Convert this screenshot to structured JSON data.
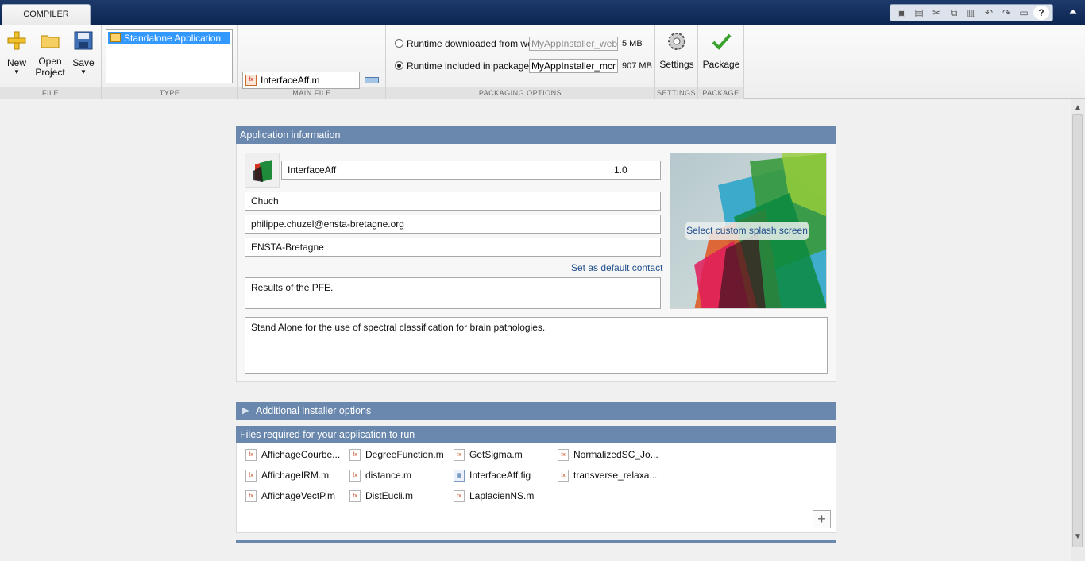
{
  "tabs": {
    "compiler": "COMPILER"
  },
  "quick_access": [
    "new-icon",
    "save-icon",
    "cut-icon",
    "copy-icon",
    "paste-icon",
    "undo-icon",
    "redo-icon",
    "window-icon",
    "help-icon"
  ],
  "toolstrip": {
    "file": {
      "section_label": "FILE",
      "new": "New",
      "open_line1": "Open",
      "open_line2": "Project",
      "save": "Save"
    },
    "type": {
      "section_label": "TYPE",
      "selected": "Standalone Application"
    },
    "main_file": {
      "section_label": "MAIN FILE",
      "file": "InterfaceAff.m"
    },
    "packaging": {
      "section_label": "PACKAGING OPTIONS",
      "web_label": "Runtime downloaded from web",
      "web_value": "MyAppInstaller_web",
      "web_size": "5 MB",
      "mcr_label": "Runtime included in package",
      "mcr_value": "MyAppInstaller_mcr",
      "mcr_size": "907 MB",
      "selected": "mcr"
    },
    "settings": {
      "section_label": "SETTINGS",
      "button": "Settings"
    },
    "package": {
      "section_label": "PACKAGE",
      "button": "Package"
    }
  },
  "app_info": {
    "header": "Application information",
    "name": "InterfaceAff",
    "version": "1.0",
    "author": "Chuch",
    "email": "philippe.chuzel@ensta-bretagne.org",
    "company": "ENSTA-Bretagne",
    "default_contact_link": "Set as default contact",
    "summary": "Results of the PFE.",
    "description": "Stand Alone for the use of spectral classification for brain pathologies.",
    "splash_button": "Select custom splash screen"
  },
  "installer_options": {
    "header": "Additional installer options"
  },
  "files_required": {
    "header": "Files required for your application to run",
    "files": [
      {
        "name": "AffichageCourbe...",
        "type": "m"
      },
      {
        "name": "AffichageIRM.m",
        "type": "m"
      },
      {
        "name": "AffichageVectP.m",
        "type": "m"
      },
      {
        "name": "DegreeFunction.m",
        "type": "m"
      },
      {
        "name": "distance.m",
        "type": "m"
      },
      {
        "name": "DistEucli.m",
        "type": "m"
      },
      {
        "name": "GetSigma.m",
        "type": "m"
      },
      {
        "name": "InterfaceAff.fig",
        "type": "fig"
      },
      {
        "name": "LaplacienNS.m",
        "type": "m"
      },
      {
        "name": "NormalizedSC_Jo...",
        "type": "m"
      },
      {
        "name": "transverse_relaxa...",
        "type": "m"
      }
    ]
  },
  "colors": {
    "panel_header": "#6a88ad",
    "link": "#1f4e8c",
    "selection": "#3399ff",
    "title_bar": "#0d2652"
  }
}
